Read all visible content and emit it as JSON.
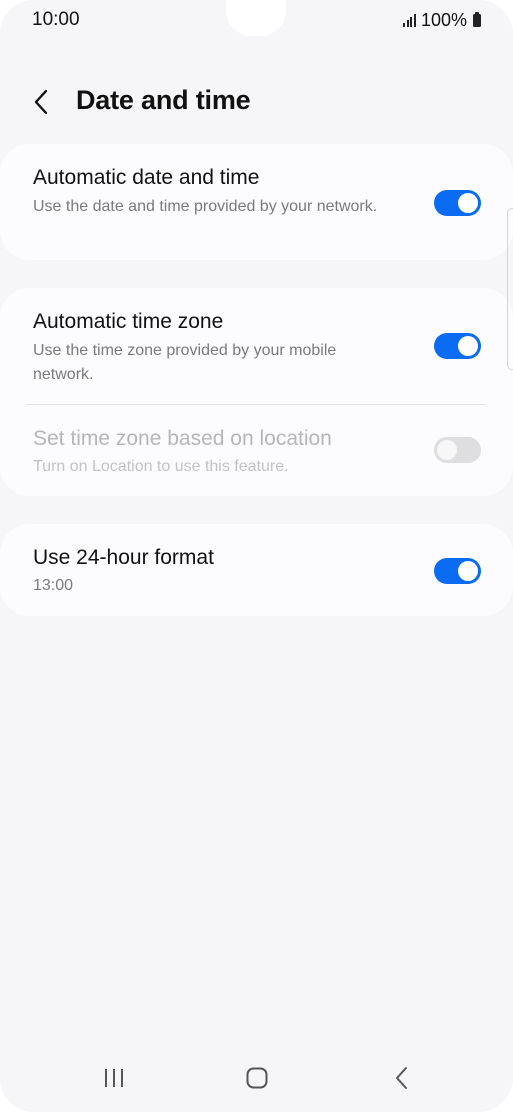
{
  "status_bar": {
    "time": "10:00",
    "battery_percent": "100%",
    "signal_icon": "cellular-signal-icon",
    "battery_icon": "battery-full-icon"
  },
  "header": {
    "title": "Date and time",
    "back_icon": "chevron-left-icon"
  },
  "settings": {
    "auto_date_time": {
      "title": "Automatic date and time",
      "subtitle": "Use the date and time provided by your network.",
      "enabled": true
    },
    "auto_time_zone": {
      "title": "Automatic time zone",
      "subtitle": "Use the time zone provided by your mobile network.",
      "enabled": true
    },
    "location_time_zone": {
      "title": "Set time zone based on location",
      "subtitle": "Turn on Location to use this feature.",
      "enabled": false,
      "disabled": true
    },
    "hour_format": {
      "title": "Use 24-hour format",
      "subtitle": "13:00",
      "enabled": true
    }
  },
  "nav_bar": {
    "recents_icon": "recent-apps-icon",
    "home_icon": "home-icon",
    "back_icon": "back-icon"
  },
  "colors": {
    "accent": "#0a6cf3",
    "background": "#f6f6f8",
    "card": "#fcfcfe"
  }
}
